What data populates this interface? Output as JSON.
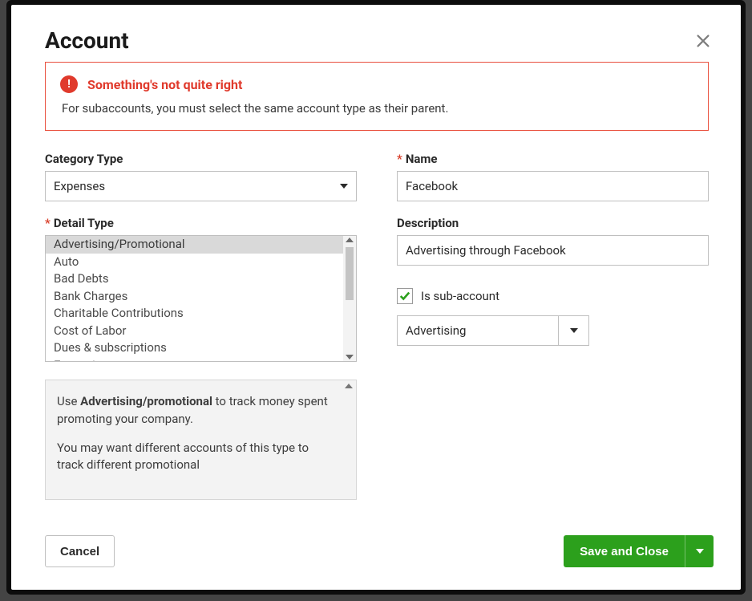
{
  "header": {
    "title": "Account"
  },
  "alert": {
    "title": "Something's not quite right",
    "message": "For subaccounts, you must select the same account type as their parent."
  },
  "left": {
    "category_label": "Category Type",
    "category_value": "Expenses",
    "detail_label": "Detail Type",
    "detail_options": [
      "Advertising/Promotional",
      "Auto",
      "Bad Debts",
      "Bank Charges",
      "Charitable Contributions",
      "Cost of Labor",
      "Dues & subscriptions",
      "Entertainment"
    ],
    "detail_selected_index": 0,
    "help_html_bold": "Advertising/promotional",
    "help_p1_pre": "Use ",
    "help_p1_post": " to track money spent promoting your company.",
    "help_p2": "You may want different accounts of this type to track different promotional"
  },
  "right": {
    "name_label": "Name",
    "name_value": "Facebook",
    "desc_label": "Description",
    "desc_value": "Advertising through Facebook",
    "sub_label": "Is sub-account",
    "sub_checked": true,
    "sub_value": "Advertising"
  },
  "footer": {
    "cancel": "Cancel",
    "save": "Save and Close"
  }
}
